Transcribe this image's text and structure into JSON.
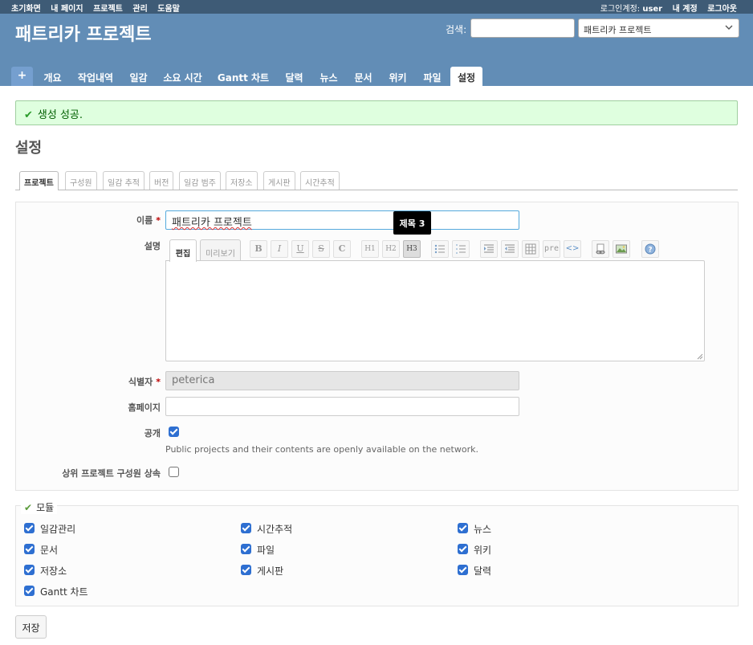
{
  "top_menu": {
    "left_items": [
      "초기화면",
      "내 페이지",
      "프로젝트",
      "관리",
      "도움말"
    ],
    "logged_in_label": "로그인계정:",
    "user": "user",
    "my_account": "내 계정",
    "logout": "로그아웃"
  },
  "header": {
    "project_title": "패트리카 프로젝트",
    "search_label": "검색:",
    "search_value": "",
    "project_jump_value": "패트리카 프로젝트"
  },
  "main_menu": {
    "plus": "+",
    "tabs": [
      "개요",
      "작업내역",
      "일감",
      "소요 시간",
      "Gantt 차트",
      "달력",
      "뉴스",
      "문서",
      "위키",
      "파일",
      "설정"
    ],
    "selected": "설정"
  },
  "flash": {
    "message": "생성 성공."
  },
  "page_title": "설정",
  "settings_tabs": {
    "items": [
      "프로젝트",
      "구성원",
      "일감 추적",
      "버전",
      "일감 범주",
      "저장소",
      "게시판",
      "시간추적"
    ],
    "selected": "프로젝트"
  },
  "form": {
    "name_label": "이름",
    "name_value": "패트리카 프로젝트",
    "description_label": "설명",
    "editor_tabs": {
      "edit": "편집",
      "preview": "미리보기"
    },
    "tooltip": "제목 3",
    "identifier_label": "식별자",
    "identifier_value": "peterica",
    "homepage_label": "홈페이지",
    "homepage_value": "",
    "public_label": "공개",
    "public_checked": true,
    "public_hint": "Public projects and their contents are openly available on the network.",
    "inherit_label": "상위 프로젝트 구성원 상속",
    "inherit_checked": false,
    "required_mark": "*"
  },
  "toolbar": {
    "bold": "B",
    "italic": "I",
    "underline": "U",
    "strike": "S",
    "code": "C",
    "h1": "H1",
    "h2": "H2",
    "h3": "H3",
    "pre": "pre",
    "inline_code": "<>"
  },
  "modules": {
    "legend": "모듈",
    "items": [
      {
        "label": "일감관리",
        "checked": true
      },
      {
        "label": "시간추적",
        "checked": true
      },
      {
        "label": "뉴스",
        "checked": true
      },
      {
        "label": "문서",
        "checked": true
      },
      {
        "label": "파일",
        "checked": true
      },
      {
        "label": "위키",
        "checked": true
      },
      {
        "label": "저장소",
        "checked": true
      },
      {
        "label": "게시판",
        "checked": true
      },
      {
        "label": "달력",
        "checked": true
      },
      {
        "label": "Gantt 차트",
        "checked": true
      }
    ]
  },
  "save_label": "저장",
  "colors": {
    "top_bar": "#3e5b76",
    "header": "#628db6",
    "flash_bg": "#dfffdf",
    "checkbox": "#2e6fd1"
  }
}
